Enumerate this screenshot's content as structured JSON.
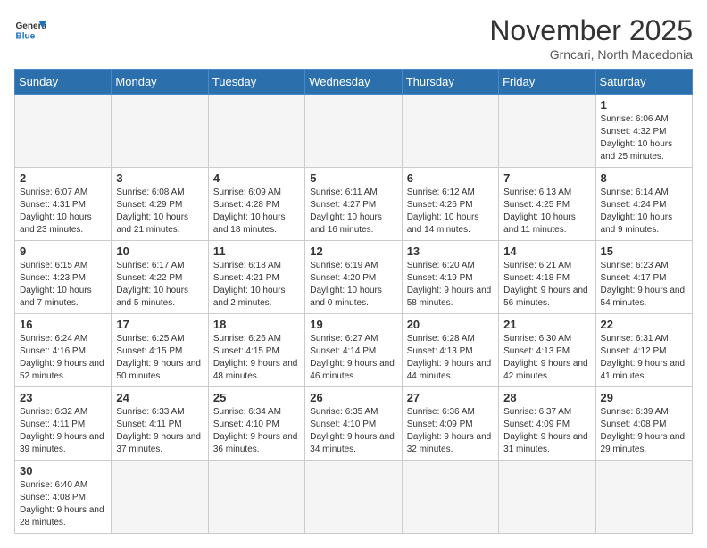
{
  "logo": {
    "general": "General",
    "blue": "Blue"
  },
  "title": "November 2025",
  "location": "Grncari, North Macedonia",
  "weekdays": [
    "Sunday",
    "Monday",
    "Tuesday",
    "Wednesday",
    "Thursday",
    "Friday",
    "Saturday"
  ],
  "weeks": [
    [
      {
        "day": "",
        "info": "",
        "empty": true
      },
      {
        "day": "",
        "info": "",
        "empty": true
      },
      {
        "day": "",
        "info": "",
        "empty": true
      },
      {
        "day": "",
        "info": "",
        "empty": true
      },
      {
        "day": "",
        "info": "",
        "empty": true
      },
      {
        "day": "",
        "info": "",
        "empty": true
      },
      {
        "day": "1",
        "info": "Sunrise: 6:06 AM\nSunset: 4:32 PM\nDaylight: 10 hours and 25 minutes.",
        "empty": false
      }
    ],
    [
      {
        "day": "2",
        "info": "Sunrise: 6:07 AM\nSunset: 4:31 PM\nDaylight: 10 hours and 23 minutes.",
        "empty": false
      },
      {
        "day": "3",
        "info": "Sunrise: 6:08 AM\nSunset: 4:29 PM\nDaylight: 10 hours and 21 minutes.",
        "empty": false
      },
      {
        "day": "4",
        "info": "Sunrise: 6:09 AM\nSunset: 4:28 PM\nDaylight: 10 hours and 18 minutes.",
        "empty": false
      },
      {
        "day": "5",
        "info": "Sunrise: 6:11 AM\nSunset: 4:27 PM\nDaylight: 10 hours and 16 minutes.",
        "empty": false
      },
      {
        "day": "6",
        "info": "Sunrise: 6:12 AM\nSunset: 4:26 PM\nDaylight: 10 hours and 14 minutes.",
        "empty": false
      },
      {
        "day": "7",
        "info": "Sunrise: 6:13 AM\nSunset: 4:25 PM\nDaylight: 10 hours and 11 minutes.",
        "empty": false
      },
      {
        "day": "8",
        "info": "Sunrise: 6:14 AM\nSunset: 4:24 PM\nDaylight: 10 hours and 9 minutes.",
        "empty": false
      }
    ],
    [
      {
        "day": "9",
        "info": "Sunrise: 6:15 AM\nSunset: 4:23 PM\nDaylight: 10 hours and 7 minutes.",
        "empty": false
      },
      {
        "day": "10",
        "info": "Sunrise: 6:17 AM\nSunset: 4:22 PM\nDaylight: 10 hours and 5 minutes.",
        "empty": false
      },
      {
        "day": "11",
        "info": "Sunrise: 6:18 AM\nSunset: 4:21 PM\nDaylight: 10 hours and 2 minutes.",
        "empty": false
      },
      {
        "day": "12",
        "info": "Sunrise: 6:19 AM\nSunset: 4:20 PM\nDaylight: 10 hours and 0 minutes.",
        "empty": false
      },
      {
        "day": "13",
        "info": "Sunrise: 6:20 AM\nSunset: 4:19 PM\nDaylight: 9 hours and 58 minutes.",
        "empty": false
      },
      {
        "day": "14",
        "info": "Sunrise: 6:21 AM\nSunset: 4:18 PM\nDaylight: 9 hours and 56 minutes.",
        "empty": false
      },
      {
        "day": "15",
        "info": "Sunrise: 6:23 AM\nSunset: 4:17 PM\nDaylight: 9 hours and 54 minutes.",
        "empty": false
      }
    ],
    [
      {
        "day": "16",
        "info": "Sunrise: 6:24 AM\nSunset: 4:16 PM\nDaylight: 9 hours and 52 minutes.",
        "empty": false
      },
      {
        "day": "17",
        "info": "Sunrise: 6:25 AM\nSunset: 4:15 PM\nDaylight: 9 hours and 50 minutes.",
        "empty": false
      },
      {
        "day": "18",
        "info": "Sunrise: 6:26 AM\nSunset: 4:15 PM\nDaylight: 9 hours and 48 minutes.",
        "empty": false
      },
      {
        "day": "19",
        "info": "Sunrise: 6:27 AM\nSunset: 4:14 PM\nDaylight: 9 hours and 46 minutes.",
        "empty": false
      },
      {
        "day": "20",
        "info": "Sunrise: 6:28 AM\nSunset: 4:13 PM\nDaylight: 9 hours and 44 minutes.",
        "empty": false
      },
      {
        "day": "21",
        "info": "Sunrise: 6:30 AM\nSunset: 4:13 PM\nDaylight: 9 hours and 42 minutes.",
        "empty": false
      },
      {
        "day": "22",
        "info": "Sunrise: 6:31 AM\nSunset: 4:12 PM\nDaylight: 9 hours and 41 minutes.",
        "empty": false
      }
    ],
    [
      {
        "day": "23",
        "info": "Sunrise: 6:32 AM\nSunset: 4:11 PM\nDaylight: 9 hours and 39 minutes.",
        "empty": false
      },
      {
        "day": "24",
        "info": "Sunrise: 6:33 AM\nSunset: 4:11 PM\nDaylight: 9 hours and 37 minutes.",
        "empty": false
      },
      {
        "day": "25",
        "info": "Sunrise: 6:34 AM\nSunset: 4:10 PM\nDaylight: 9 hours and 36 minutes.",
        "empty": false
      },
      {
        "day": "26",
        "info": "Sunrise: 6:35 AM\nSunset: 4:10 PM\nDaylight: 9 hours and 34 minutes.",
        "empty": false
      },
      {
        "day": "27",
        "info": "Sunrise: 6:36 AM\nSunset: 4:09 PM\nDaylight: 9 hours and 32 minutes.",
        "empty": false
      },
      {
        "day": "28",
        "info": "Sunrise: 6:37 AM\nSunset: 4:09 PM\nDaylight: 9 hours and 31 minutes.",
        "empty": false
      },
      {
        "day": "29",
        "info": "Sunrise: 6:39 AM\nSunset: 4:08 PM\nDaylight: 9 hours and 29 minutes.",
        "empty": false
      }
    ],
    [
      {
        "day": "30",
        "info": "Sunrise: 6:40 AM\nSunset: 4:08 PM\nDaylight: 9 hours and 28 minutes.",
        "empty": false
      },
      {
        "day": "",
        "info": "",
        "empty": true
      },
      {
        "day": "",
        "info": "",
        "empty": true
      },
      {
        "day": "",
        "info": "",
        "empty": true
      },
      {
        "day": "",
        "info": "",
        "empty": true
      },
      {
        "day": "",
        "info": "",
        "empty": true
      },
      {
        "day": "",
        "info": "",
        "empty": true
      }
    ]
  ]
}
